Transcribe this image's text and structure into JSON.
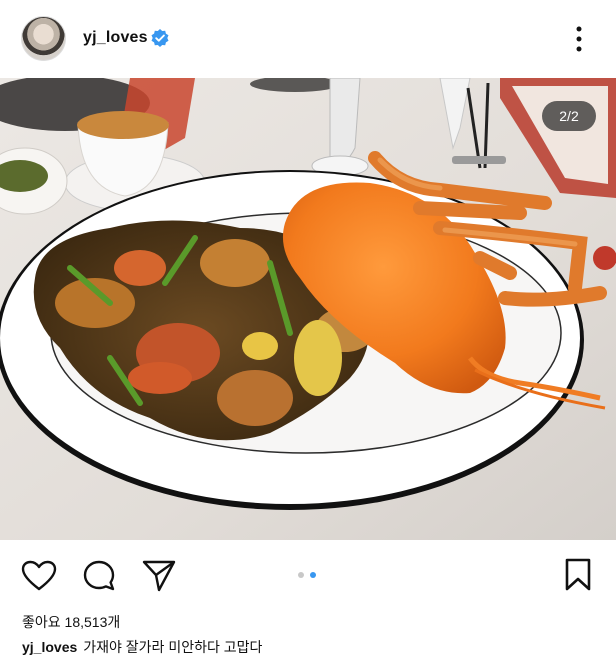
{
  "post": {
    "username": "yj_loves",
    "verified": true,
    "image_counter": "2/2",
    "likes_label": "좋아요",
    "likes_count": "18,513개",
    "caption_user": "yj_loves",
    "caption_text": "가재야 잘가라 미안하다 고맙다",
    "carousel": {
      "total": 2,
      "active": 2
    }
  },
  "icons": {
    "more": "more-vertical-icon",
    "verified": "verified-badge-icon",
    "like": "heart-icon",
    "comment": "comment-icon",
    "share": "send-icon",
    "save": "bookmark-icon"
  },
  "colors": {
    "verified_blue": "#3897f0",
    "carousel_active": "#3897f0",
    "carousel_inactive": "#c8c8c8"
  }
}
